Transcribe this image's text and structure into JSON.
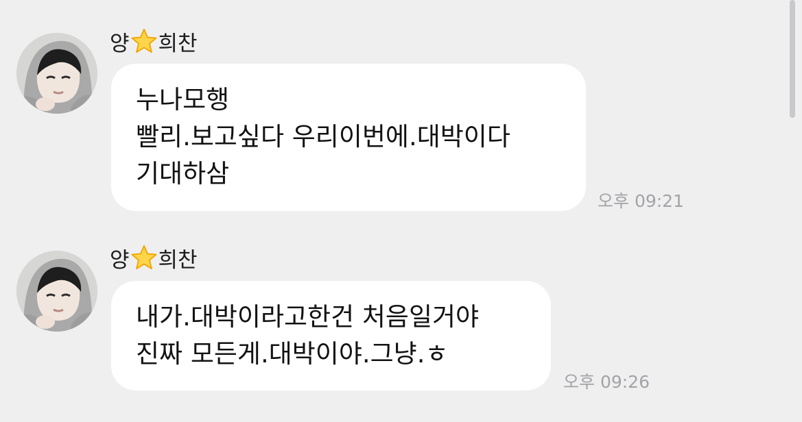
{
  "chat": {
    "messages": [
      {
        "sender_first": "양",
        "sender_emoji": "star-emoji",
        "sender_last": "희찬",
        "lines": [
          "누나모행",
          "빨리.보고싶다 우리이번에.대박이다",
          "기대하삼"
        ],
        "time": "오후 09:21"
      },
      {
        "sender_first": "양",
        "sender_emoji": "star-emoji",
        "sender_last": "희찬",
        "lines": [
          "내가.대박이라고한건 처음일거야",
          "진짜 모든게.대박이야.그냥.ㅎ"
        ],
        "time": "오후 09:26"
      }
    ]
  },
  "colors": {
    "background": "#efeff0",
    "bubble": "#ffffff",
    "timestamp": "#a3a3a7"
  }
}
